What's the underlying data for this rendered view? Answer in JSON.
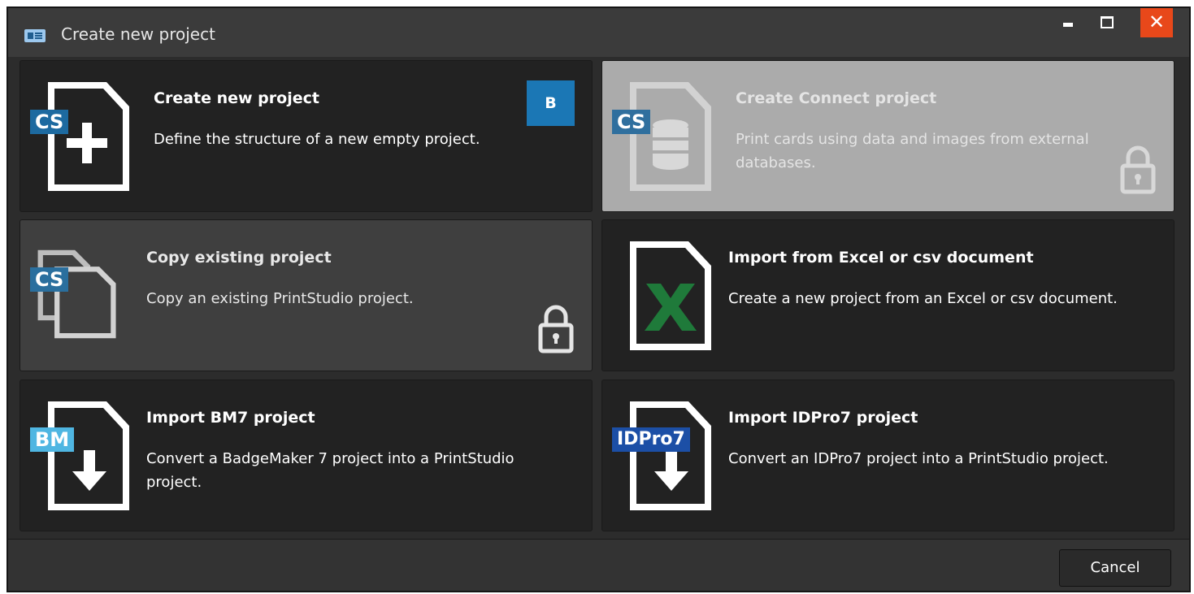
{
  "window": {
    "title": "Create new project",
    "close_glyph": "✕"
  },
  "tiles": [
    {
      "title": "Create new project",
      "description": "Define the structure of a new empty project.",
      "tag": "CS",
      "badge": "B",
      "icon": "document-plus-icon"
    },
    {
      "title": "Create Connect project",
      "description": "Print cards using data and images from external databases.",
      "tag": "CS",
      "icon": "document-database-icon",
      "locked": true
    },
    {
      "title": "Copy existing project",
      "description": "Copy an existing PrintStudio project.",
      "tag": "CS",
      "icon": "document-copy-icon",
      "locked": true
    },
    {
      "title": "Import from Excel or csv document",
      "description": "Create a new project from an Excel or csv document.",
      "icon": "excel-document-icon"
    },
    {
      "title": "Import BM7 project",
      "description": "Convert a BadgeMaker 7 project into a PrintStudio project.",
      "tag": "BM",
      "icon": "document-import-icon"
    },
    {
      "title": "Import IDPro7 project",
      "description": "Convert an IDPro7 project into a PrintStudio project.",
      "tag": "IDPro7",
      "icon": "document-import-icon"
    }
  ],
  "footer": {
    "cancel_label": "Cancel"
  },
  "colors": {
    "accent": "#1b77b5",
    "close_button": "#e8481a",
    "excel_green": "#1f7a3a"
  }
}
